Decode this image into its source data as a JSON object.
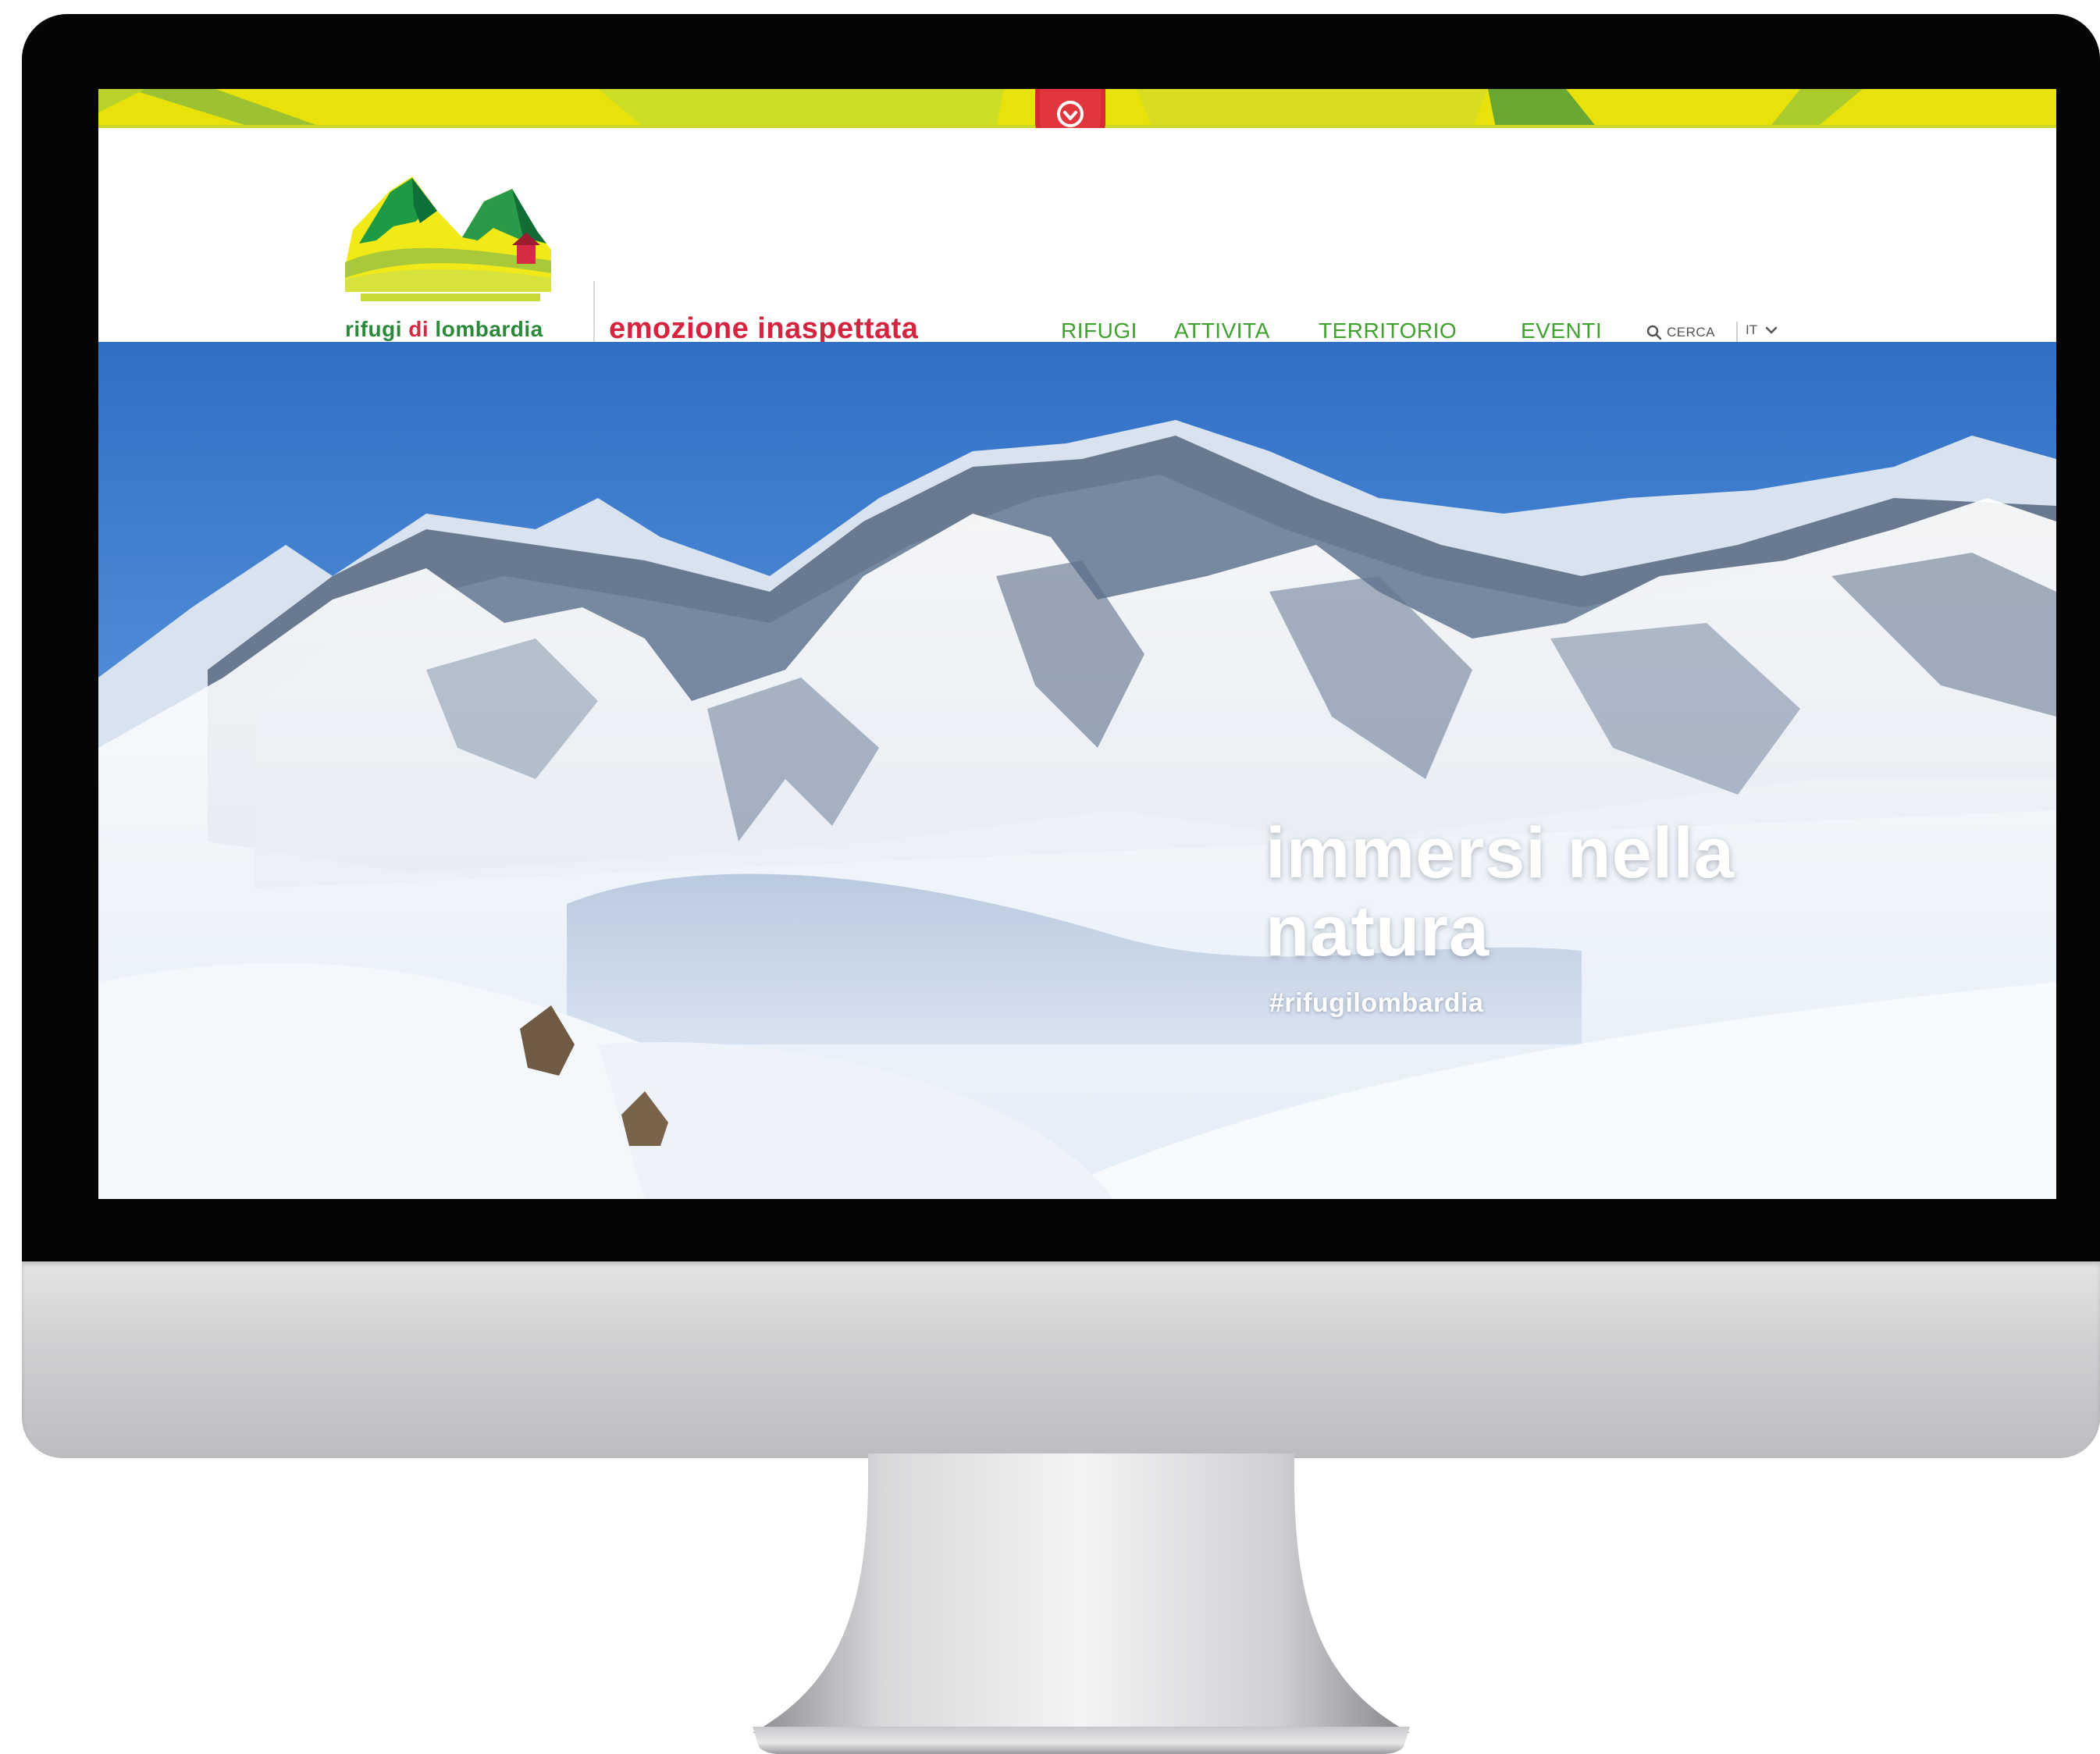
{
  "brand": {
    "logo_text_main": "rifugi ",
    "logo_text_accent": "di",
    "logo_text_end": " lombardia",
    "tagline": "emozione inaspettata"
  },
  "nav": {
    "items": [
      {
        "label": "RIFUGI"
      },
      {
        "label": "ATTIVITA"
      },
      {
        "label": "TERRITORIO"
      },
      {
        "label": "EVENTI"
      }
    ],
    "search_label": "CERCA",
    "language": "IT"
  },
  "hero": {
    "title_line1": "immersi nella",
    "title_line2": "natura",
    "hashtag": "#rifugilombardia"
  },
  "colors": {
    "nav_green": "#3fa22e",
    "tagline_red": "#d5243f",
    "topbar_yellow": "#e8e20a",
    "sky_blue": "#3c7fd2"
  },
  "icons": {
    "badge": "heart-badge-icon",
    "search": "search-icon",
    "language": "chevron-down-icon"
  }
}
